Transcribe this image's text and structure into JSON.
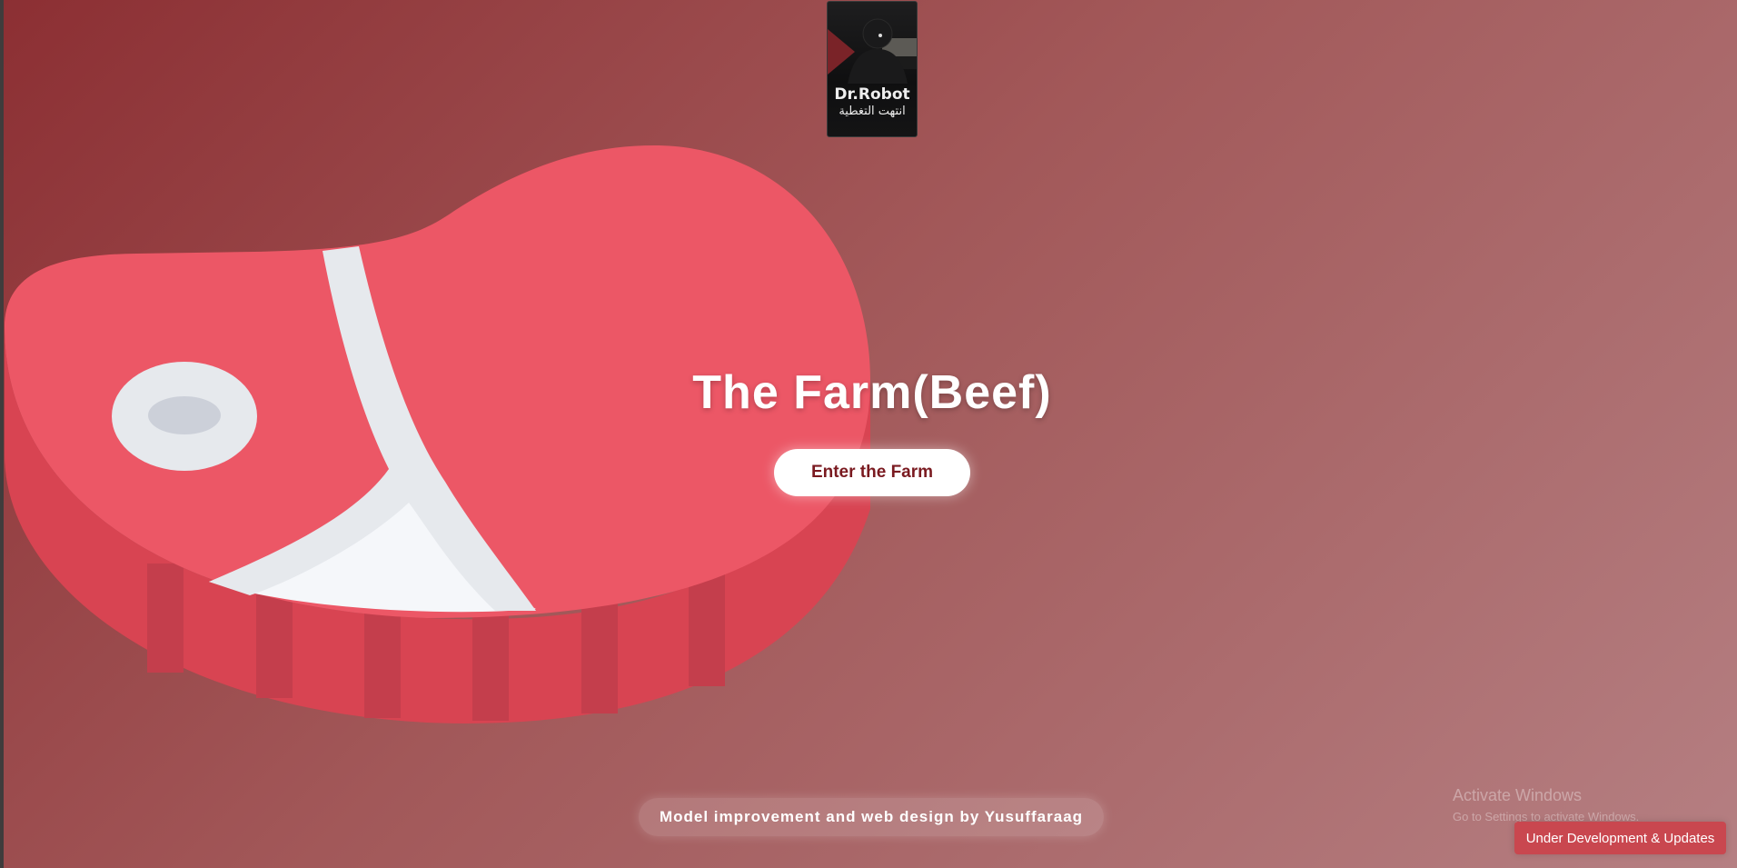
{
  "logo": {
    "title": "Dr.Robot",
    "subtitle": "انتهت التغطية"
  },
  "hero": {
    "title": "The Farm(Beef)",
    "enter_button": "Enter the Farm"
  },
  "footer": {
    "credit": "Model improvement and web design by Yusuffaraag",
    "status_badge": "Under Development & Updates"
  },
  "watermark": {
    "title": "Activate Windows",
    "subtitle": "Go to Settings to activate Windows."
  },
  "colors": {
    "meat": "#ec5766",
    "meat_side": "#d84452",
    "fat": "#e6e9ed",
    "bone": "#f5f7fa",
    "accent": "#7a1a20"
  }
}
